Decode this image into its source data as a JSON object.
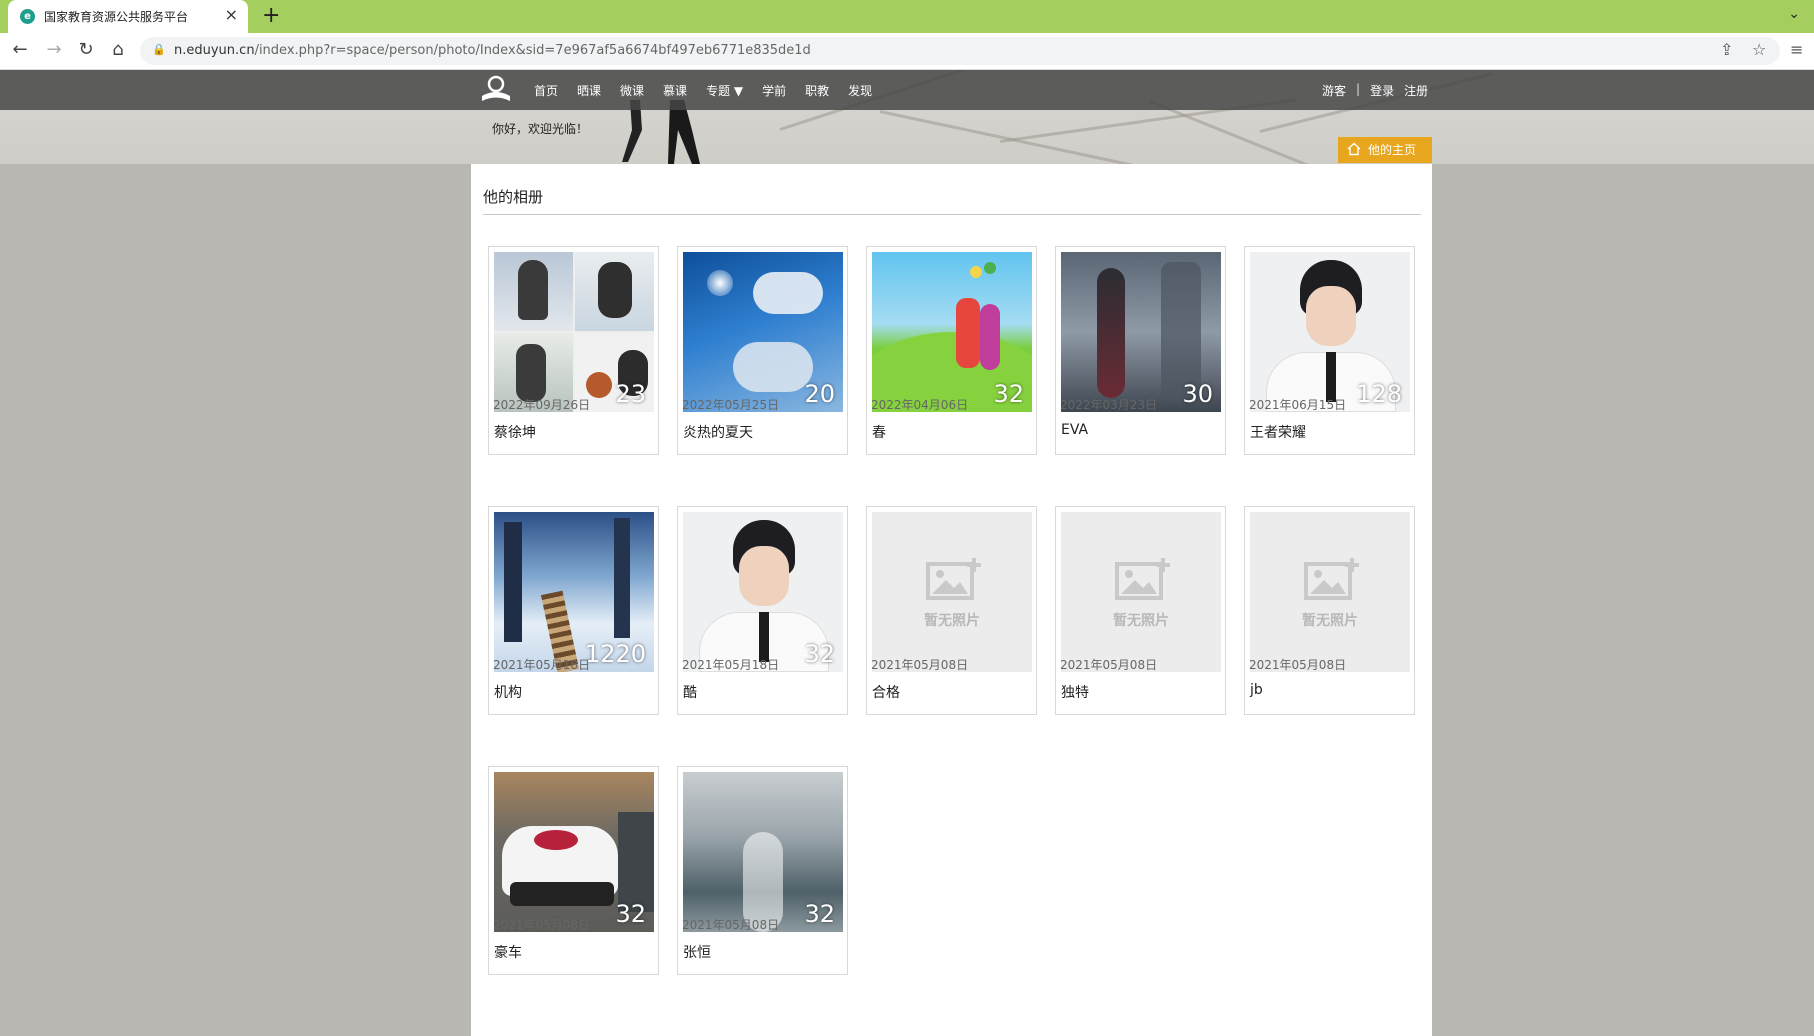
{
  "browser": {
    "tab_title": "国家教育资源公共服务平台",
    "url_domain": "n.eduyun.cn",
    "url_path": "/index.php?r=space/person/photo/Index&sid=7e967af5a6674bf497eb6771e835de1d"
  },
  "site_nav": {
    "items": [
      "首页",
      "晒课",
      "微课",
      "慕课",
      "专题 ▼",
      "学前",
      "职教",
      "发现"
    ],
    "right": [
      "游客",
      "|",
      "登录",
      "注册"
    ]
  },
  "welcome": "你好，欢迎光临！",
  "home_button": "他的主页",
  "section_title": "他的相册",
  "albums": [
    {
      "name": "蔡徐坤",
      "count": "23",
      "date": "2022年09月26日"
    },
    {
      "name": "炎热的夏天",
      "count": "20",
      "date": "2022年05月25日"
    },
    {
      "name": "春",
      "count": "32",
      "date": "2022年04月06日"
    },
    {
      "name": "EVA",
      "count": "30",
      "date": "2022年03月23日"
    },
    {
      "name": "王者荣耀",
      "count": "128",
      "date": "2021年06月15日"
    },
    {
      "name": "机构",
      "count": "1220",
      "date": "2021年05月18日"
    },
    {
      "name": "酷",
      "count": "32",
      "date": "2021年05月18日"
    },
    {
      "name": "合格",
      "count": "",
      "date": "2021年05月08日",
      "empty_label": "暂无照片"
    },
    {
      "name": "独特",
      "count": "",
      "date": "2021年05月08日",
      "empty_label": "暂无照片"
    },
    {
      "name": "jb",
      "count": "",
      "date": "2021年05月08日",
      "empty_label": "暂无照片"
    },
    {
      "name": "豪车",
      "count": "32",
      "date": "2021年05月08日"
    },
    {
      "name": "张恒",
      "count": "32",
      "date": "2021年05月08日"
    }
  ],
  "colors": {
    "tabbar": "#a4cf5f",
    "nav_bar": "#464646",
    "home_button": "#e8a61e",
    "page_bg": "#b9b7b1"
  }
}
